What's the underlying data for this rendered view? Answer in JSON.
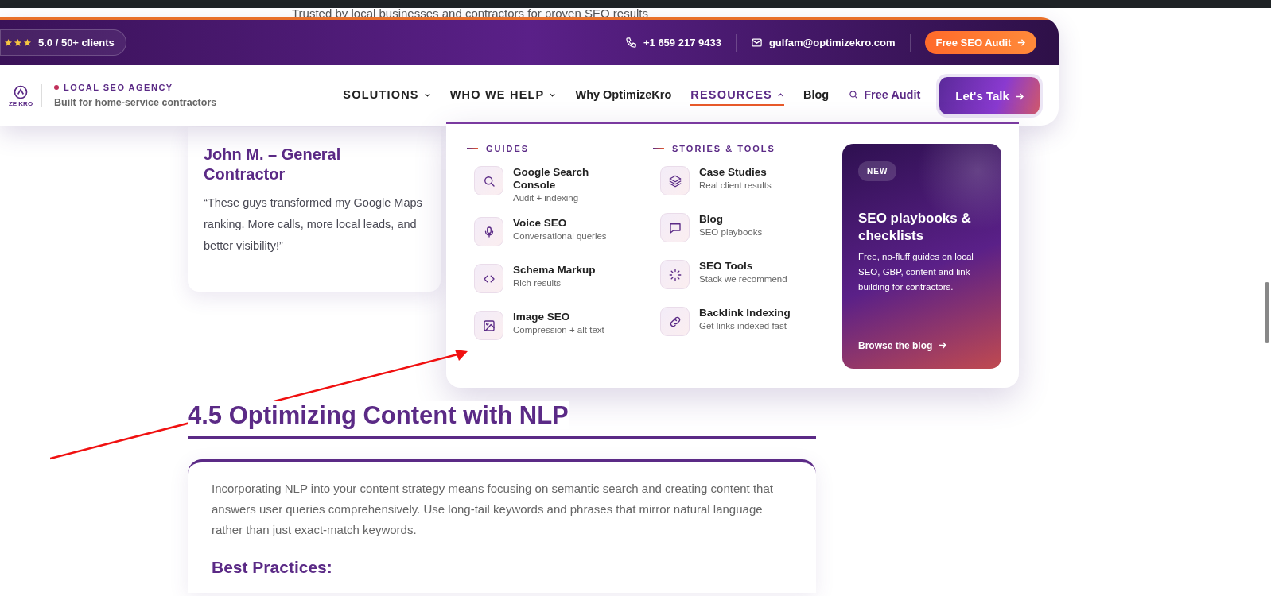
{
  "tagline": "Trusted by local businesses and contractors for proven SEO results",
  "top_bar": {
    "stars": 3,
    "rating": "5.0 / 50+ clients",
    "phone": "+1 659 217 9433",
    "email": "gulfam@optimizekro.com",
    "cta": "Free SEO Audit"
  },
  "brand": {
    "logo_text": "ZE KRO",
    "eyebrow": "LOCAL SEO AGENCY",
    "subtitle": "Built for home-service contractors"
  },
  "nav": [
    {
      "label": "SOLUTIONS",
      "kind": "menu",
      "expanded": false,
      "selected": false
    },
    {
      "label": "WHO WE HELP",
      "kind": "menu",
      "expanded": false,
      "selected": false
    },
    {
      "label": "Why OptimizeKro",
      "kind": "link",
      "selected": false
    },
    {
      "label": "RESOURCES",
      "kind": "menu",
      "expanded": true,
      "selected": true
    },
    {
      "label": "Blog",
      "kind": "link",
      "selected": false
    },
    {
      "label": "Free Audit",
      "kind": "search",
      "selected": false
    }
  ],
  "nav_button": "Let's Talk",
  "dropdown": {
    "columns": [
      {
        "heading": "GUIDES",
        "items": [
          {
            "title": "Google Search Console",
            "subtitle": "Audit + indexing"
          },
          {
            "title": "Voice SEO",
            "subtitle": "Conversational queries"
          },
          {
            "title": "Schema Markup",
            "subtitle": "Rich results"
          },
          {
            "title": "Image SEO",
            "subtitle": "Compression + alt text"
          }
        ]
      },
      {
        "heading": "STORIES & TOOLS",
        "items": [
          {
            "title": "Case Studies",
            "subtitle": "Real client results"
          },
          {
            "title": "Blog",
            "subtitle": "SEO playbooks"
          },
          {
            "title": "SEO Tools",
            "subtitle": "Stack we recommend"
          },
          {
            "title": "Backlink Indexing",
            "subtitle": "Get links indexed fast"
          }
        ]
      }
    ],
    "promo": {
      "badge": "NEW",
      "title": "SEO playbooks & checklists",
      "text": "Free, no-fluff guides on local SEO, GBP, content and link-building for contractors.",
      "link": "Browse the blog"
    }
  },
  "testimonial": {
    "name": "John M. – General Contractor",
    "quote": "“These guys transformed my Google Maps ranking. More calls, more local leads, and better visibility!”"
  },
  "section": {
    "heading": "4.5 Optimizing Content with NLP",
    "paragraph": "Incorporating NLP into your content strategy means focusing on semantic search and creating content that answers user queries comprehensively. Use long-tail keywords and phrases that mirror natural language rather than just exact-match keywords.",
    "subheading": "Best Practices:"
  }
}
